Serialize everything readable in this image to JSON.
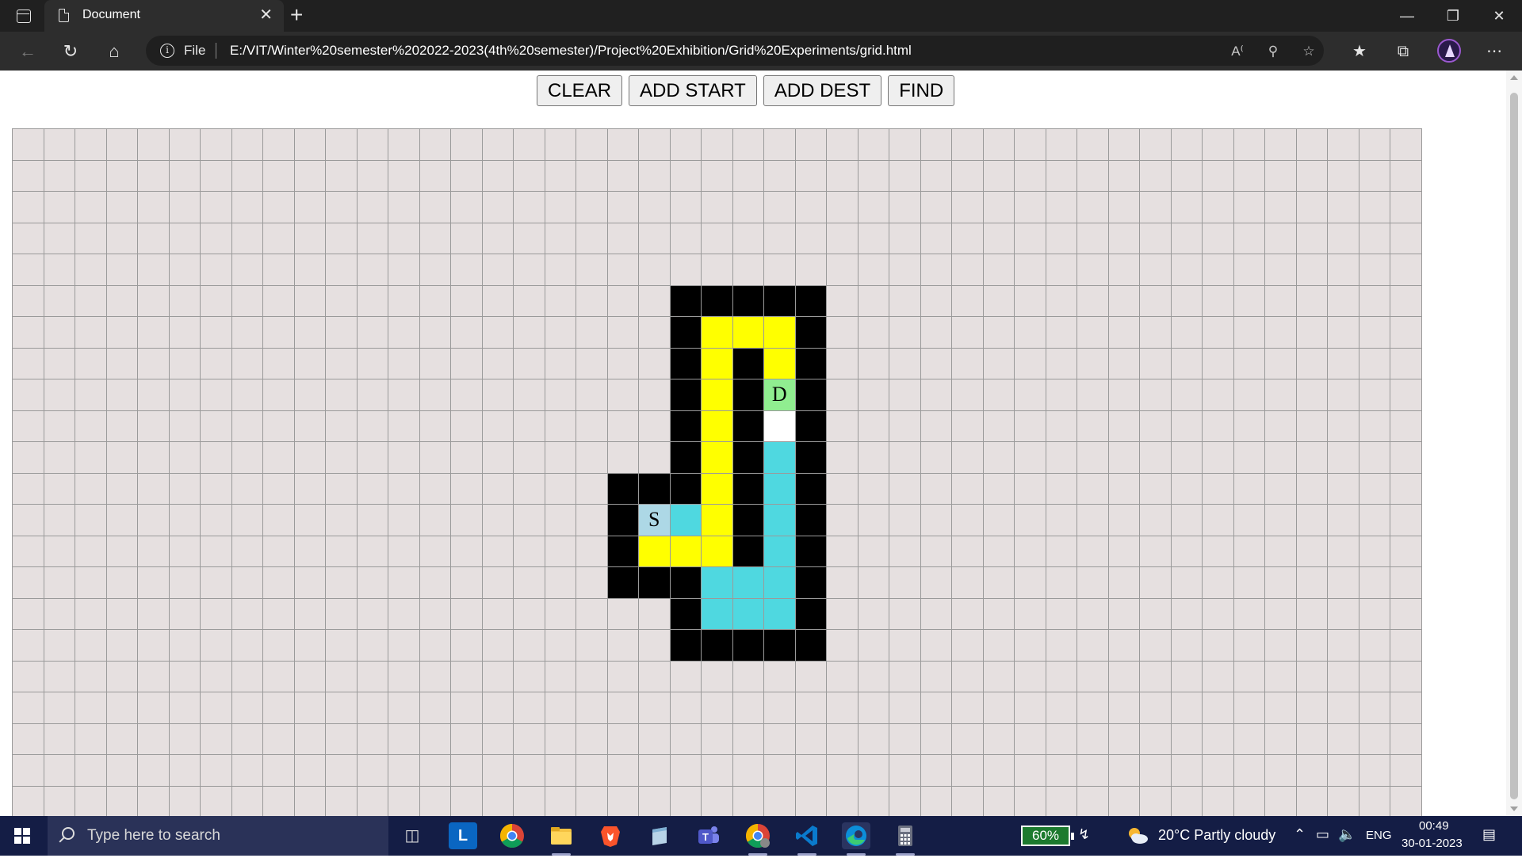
{
  "browser": {
    "tab_title": "Document",
    "new_tab_symbol": "+",
    "close_symbol": "✕",
    "address_scheme": "File",
    "url": "E:/VIT/Winter%20semester%202022-2023(4th%20semester)/Project%20Exhibition/Grid%20Experiments/grid.html",
    "read_aloud_label": "A⁾"
  },
  "controls": {
    "clear": "CLEAR",
    "add_start": "ADD START",
    "add_dest": "ADD DEST",
    "find": "FIND"
  },
  "grid": {
    "columns": 45,
    "rows": 22,
    "colors": {
      "empty": "#e6e0e0",
      "wall": "#000000",
      "explored": "#ffff00",
      "path": "#4fd8e0",
      "start": "#add8e6",
      "dest": "#90ee90",
      "open": "#ffffff"
    },
    "start_label": "S",
    "dest_label": "D",
    "start": [
      12,
      20
    ],
    "dest": [
      8,
      24
    ],
    "walls": [
      [
        5,
        21
      ],
      [
        5,
        22
      ],
      [
        5,
        23
      ],
      [
        5,
        24
      ],
      [
        5,
        25
      ],
      [
        6,
        21
      ],
      [
        6,
        25
      ],
      [
        7,
        21
      ],
      [
        7,
        23
      ],
      [
        7,
        25
      ],
      [
        8,
        21
      ],
      [
        8,
        23
      ],
      [
        8,
        25
      ],
      [
        9,
        21
      ],
      [
        9,
        23
      ],
      [
        9,
        25
      ],
      [
        10,
        21
      ],
      [
        10,
        23
      ],
      [
        10,
        25
      ],
      [
        11,
        19
      ],
      [
        11,
        20
      ],
      [
        11,
        21
      ],
      [
        11,
        23
      ],
      [
        11,
        25
      ],
      [
        12,
        19
      ],
      [
        12,
        23
      ],
      [
        12,
        25
      ],
      [
        13,
        19
      ],
      [
        13,
        23
      ],
      [
        13,
        25
      ],
      [
        14,
        19
      ],
      [
        14,
        20
      ],
      [
        14,
        21
      ],
      [
        14,
        25
      ],
      [
        15,
        21
      ],
      [
        15,
        25
      ],
      [
        16,
        21
      ],
      [
        16,
        22
      ],
      [
        16,
        23
      ],
      [
        16,
        24
      ],
      [
        16,
        25
      ]
    ],
    "explored": [
      [
        6,
        22
      ],
      [
        6,
        23
      ],
      [
        6,
        24
      ],
      [
        7,
        22
      ],
      [
        7,
        24
      ],
      [
        8,
        22
      ],
      [
        9,
        22
      ],
      [
        10,
        22
      ],
      [
        11,
        22
      ],
      [
        12,
        22
      ],
      [
        13,
        20
      ],
      [
        13,
        21
      ],
      [
        13,
        22
      ]
    ],
    "path": [
      [
        10,
        24
      ],
      [
        11,
        24
      ],
      [
        12,
        24
      ],
      [
        13,
        24
      ],
      [
        12,
        21
      ],
      [
        14,
        22
      ],
      [
        14,
        23
      ],
      [
        14,
        24
      ],
      [
        15,
        22
      ],
      [
        15,
        23
      ],
      [
        15,
        24
      ]
    ],
    "open": [
      [
        9,
        24
      ]
    ]
  },
  "taskbar": {
    "search_placeholder": "Type here to search",
    "battery": "60%",
    "weather": "20°C  Partly cloudy",
    "language": "ENG",
    "time": "00:49",
    "date": "30-01-2023",
    "apps": [
      "task-view",
      "linkedin-learning",
      "chrome",
      "file-explorer",
      "brave",
      "notes",
      "teams",
      "chrome-profile",
      "vscode",
      "edge",
      "calculator"
    ]
  }
}
